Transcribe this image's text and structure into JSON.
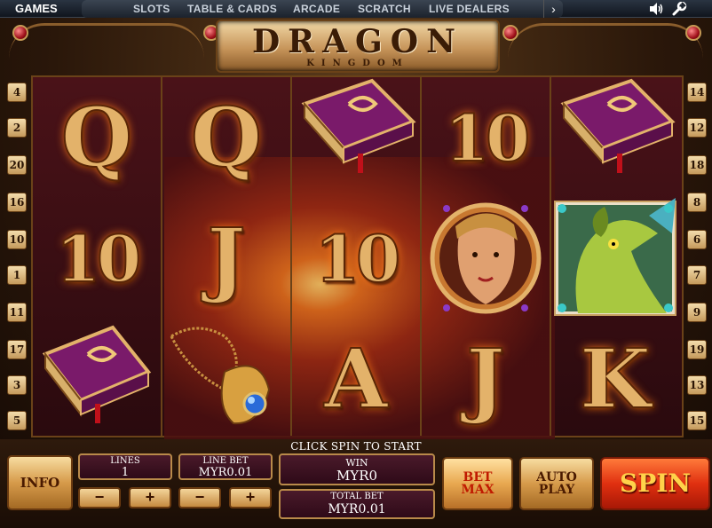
{
  "topbar": {
    "games_label": "GAMES",
    "nav_items": [
      "SLOTS",
      "TABLE & CARDS",
      "ARCADE",
      "SCRATCH",
      "LIVE DEALERS"
    ],
    "next_arrow": "›"
  },
  "game": {
    "title": "DRAGON",
    "subtitle": "KINGDOM"
  },
  "line_markers": {
    "left": [
      "4",
      "2",
      "20",
      "16",
      "10",
      "1",
      "11",
      "17",
      "3",
      "5"
    ],
    "right": [
      "14",
      "12",
      "18",
      "8",
      "6",
      "7",
      "9",
      "19",
      "13",
      "15"
    ]
  },
  "reels": [
    [
      "Q",
      "10",
      "spellbook"
    ],
    [
      "Q",
      "J",
      "dragon-amulet"
    ],
    [
      "spellbook",
      "10",
      "A"
    ],
    [
      "10",
      "warrior-princess",
      "J"
    ],
    [
      "spellbook",
      "dragon",
      "K"
    ]
  ],
  "controls": {
    "status_text": "CLICK SPIN TO START",
    "info_label": "INFO",
    "lines_label": "LINES",
    "lines_value": "1",
    "line_bet_label": "LINE BET",
    "line_bet_value": "MYR0.01",
    "minus": "−",
    "plus": "+",
    "win_label": "WIN",
    "win_value": "MYR0",
    "total_bet_label": "TOTAL BET",
    "total_bet_value": "MYR0.01",
    "bet_max_line1": "BET",
    "bet_max_line2": "MAX",
    "auto_play_line1": "AUTO",
    "auto_play_line2": "PLAY",
    "spin_label": "SPIN"
  },
  "colors": {
    "gold": "#e3b26a",
    "reel_bg": "#4a1218",
    "spin_red": "#e03010"
  }
}
